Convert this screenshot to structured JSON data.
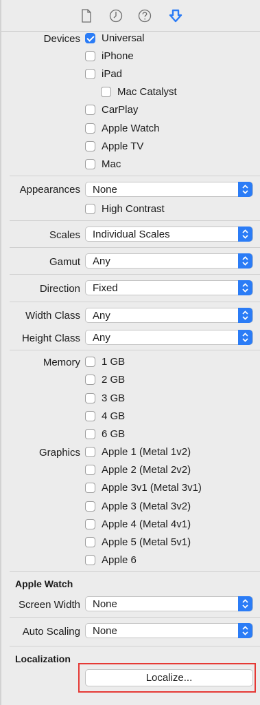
{
  "toolbar": {
    "icons": [
      "file-inspector-icon",
      "history-inspector-icon",
      "quick-help-icon",
      "attributes-inspector-icon"
    ],
    "accent": "#2b7cf6"
  },
  "devices": {
    "label": "Devices",
    "universal": "Universal",
    "iphone": "iPhone",
    "ipad": "iPad",
    "mac_catalyst": "Mac Catalyst",
    "carplay": "CarPlay",
    "apple_watch": "Apple Watch",
    "apple_tv": "Apple TV",
    "mac": "Mac",
    "checked": [
      "Universal"
    ]
  },
  "appearances": {
    "label": "Appearances",
    "value": "None",
    "high_contrast": "High Contrast"
  },
  "scales": {
    "label": "Scales",
    "value": "Individual Scales"
  },
  "gamut": {
    "label": "Gamut",
    "value": "Any"
  },
  "direction": {
    "label": "Direction",
    "value": "Fixed"
  },
  "width_class": {
    "label": "Width Class",
    "value": "Any"
  },
  "height_class": {
    "label": "Height Class",
    "value": "Any"
  },
  "memory": {
    "label": "Memory",
    "options": [
      "1 GB",
      "2 GB",
      "3 GB",
      "4 GB",
      "6 GB"
    ]
  },
  "graphics": {
    "label": "Graphics",
    "options": [
      "Apple 1 (Metal 1v2)",
      "Apple 2 (Metal 2v2)",
      "Apple 3v1 (Metal 3v1)",
      "Apple 3 (Metal 3v2)",
      "Apple 4 (Metal 4v1)",
      "Apple 5 (Metal 5v1)",
      "Apple 6"
    ]
  },
  "apple_watch_section": {
    "title": "Apple Watch",
    "screen_width_label": "Screen Width",
    "screen_width_value": "None",
    "auto_scaling_label": "Auto Scaling",
    "auto_scaling_value": "None"
  },
  "localization": {
    "title": "Localization",
    "button": "Localize...",
    "highlight_color": "#e53935"
  }
}
